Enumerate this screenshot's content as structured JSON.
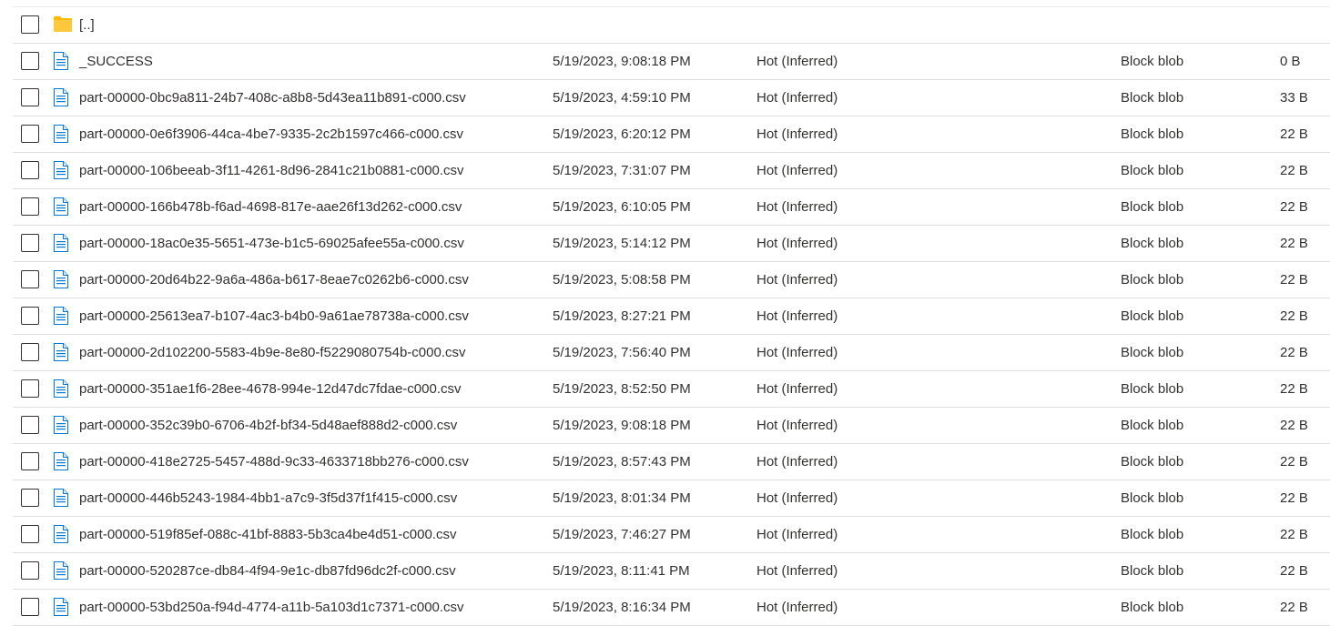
{
  "parent_row": {
    "name": "[..]",
    "icon": "folder-icon"
  },
  "rows": [
    {
      "name": "_SUCCESS",
      "modified": "5/19/2023, 9:08:18 PM",
      "tier": "Hot (Inferred)",
      "type": "Block blob",
      "size": "0 B"
    },
    {
      "name": "part-00000-0bc9a811-24b7-408c-a8b8-5d43ea11b891-c000.csv",
      "modified": "5/19/2023, 4:59:10 PM",
      "tier": "Hot (Inferred)",
      "type": "Block blob",
      "size": "33 B"
    },
    {
      "name": "part-00000-0e6f3906-44ca-4be7-9335-2c2b1597c466-c000.csv",
      "modified": "5/19/2023, 6:20:12 PM",
      "tier": "Hot (Inferred)",
      "type": "Block blob",
      "size": "22 B"
    },
    {
      "name": "part-00000-106beeab-3f11-4261-8d96-2841c21b0881-c000.csv",
      "modified": "5/19/2023, 7:31:07 PM",
      "tier": "Hot (Inferred)",
      "type": "Block blob",
      "size": "22 B"
    },
    {
      "name": "part-00000-166b478b-f6ad-4698-817e-aae26f13d262-c000.csv",
      "modified": "5/19/2023, 6:10:05 PM",
      "tier": "Hot (Inferred)",
      "type": "Block blob",
      "size": "22 B"
    },
    {
      "name": "part-00000-18ac0e35-5651-473e-b1c5-69025afee55a-c000.csv",
      "modified": "5/19/2023, 5:14:12 PM",
      "tier": "Hot (Inferred)",
      "type": "Block blob",
      "size": "22 B"
    },
    {
      "name": "part-00000-20d64b22-9a6a-486a-b617-8eae7c0262b6-c000.csv",
      "modified": "5/19/2023, 5:08:58 PM",
      "tier": "Hot (Inferred)",
      "type": "Block blob",
      "size": "22 B"
    },
    {
      "name": "part-00000-25613ea7-b107-4ac3-b4b0-9a61ae78738a-c000.csv",
      "modified": "5/19/2023, 8:27:21 PM",
      "tier": "Hot (Inferred)",
      "type": "Block blob",
      "size": "22 B"
    },
    {
      "name": "part-00000-2d102200-5583-4b9e-8e80-f5229080754b-c000.csv",
      "modified": "5/19/2023, 7:56:40 PM",
      "tier": "Hot (Inferred)",
      "type": "Block blob",
      "size": "22 B"
    },
    {
      "name": "part-00000-351ae1f6-28ee-4678-994e-12d47dc7fdae-c000.csv",
      "modified": "5/19/2023, 8:52:50 PM",
      "tier": "Hot (Inferred)",
      "type": "Block blob",
      "size": "22 B"
    },
    {
      "name": "part-00000-352c39b0-6706-4b2f-bf34-5d48aef888d2-c000.csv",
      "modified": "5/19/2023, 9:08:18 PM",
      "tier": "Hot (Inferred)",
      "type": "Block blob",
      "size": "22 B"
    },
    {
      "name": "part-00000-418e2725-5457-488d-9c33-4633718bb276-c000.csv",
      "modified": "5/19/2023, 8:57:43 PM",
      "tier": "Hot (Inferred)",
      "type": "Block blob",
      "size": "22 B"
    },
    {
      "name": "part-00000-446b5243-1984-4bb1-a7c9-3f5d37f1f415-c000.csv",
      "modified": "5/19/2023, 8:01:34 PM",
      "tier": "Hot (Inferred)",
      "type": "Block blob",
      "size": "22 B"
    },
    {
      "name": "part-00000-519f85ef-088c-41bf-8883-5b3ca4be4d51-c000.csv",
      "modified": "5/19/2023, 7:46:27 PM",
      "tier": "Hot (Inferred)",
      "type": "Block blob",
      "size": "22 B"
    },
    {
      "name": "part-00000-520287ce-db84-4f94-9e1c-db87fd96dc2f-c000.csv",
      "modified": "5/19/2023, 8:11:41 PM",
      "tier": "Hot (Inferred)",
      "type": "Block blob",
      "size": "22 B"
    },
    {
      "name": "part-00000-53bd250a-f94d-4774-a11b-5a103d1c7371-c000.csv",
      "modified": "5/19/2023, 8:16:34 PM",
      "tier": "Hot (Inferred)",
      "type": "Block blob",
      "size": "22 B"
    }
  ],
  "file_icon": "file-icon",
  "colors": {
    "folder": "#ffb900",
    "file_icon": "#0078d4",
    "divider": "#e1dfdd",
    "text": "#323130"
  }
}
